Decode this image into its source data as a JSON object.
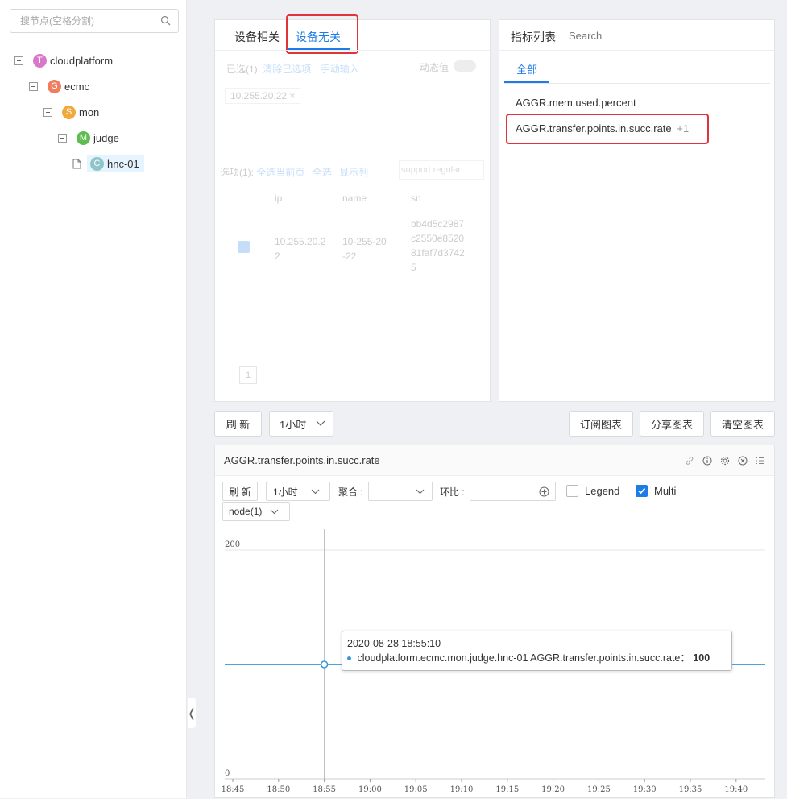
{
  "sidebar": {
    "search_placeholder": "搜节点(空格分割)",
    "tree": [
      {
        "badge": "T",
        "label": "cloudplatform",
        "color": "#d977c9"
      },
      {
        "badge": "G",
        "label": "ecmc",
        "color": "#ef7e5f"
      },
      {
        "badge": "S",
        "label": "mon",
        "color": "#f2a93b"
      },
      {
        "badge": "M",
        "label": "judge",
        "color": "#5fbd4f"
      },
      {
        "badge": "C",
        "label": "hnc-01",
        "color": "#8ec6c9"
      }
    ],
    "collapse_glyph": "❬"
  },
  "device_panel": {
    "tab_related": "设备相关",
    "tab_unrelated": "设备无关",
    "selected_label": "已选(1):",
    "clear_selected": "清除已选项",
    "manual_input": "手动输入",
    "dynamic_label": "动态值",
    "selected_tag": "10.255.20.22 ×",
    "options_label": "选项(1):",
    "select_page": "全选当前页",
    "select_all": "全选",
    "show_cols": "显示列",
    "regex_placeholder": "support regular",
    "columns": [
      "ip",
      "name",
      "sn"
    ],
    "row": [
      "10.255.20.22",
      "10-255-20-22",
      "bb4d5c2987c2550e852081faf7d37425"
    ],
    "page": "1"
  },
  "metric_panel": {
    "title": "指标列表",
    "search_placeholder": "Search",
    "tab_all": "全部",
    "items": [
      {
        "label": "AGGR.mem.used.percent",
        "suffix": ""
      },
      {
        "label": "AGGR.transfer.points.in.succ.rate",
        "suffix": "+1"
      }
    ]
  },
  "toolbar": {
    "refresh": "刷 新",
    "timerange": "1小时",
    "subscribe": "订阅图表",
    "share": "分享图表",
    "clear": "清空图表"
  },
  "chart_panel": {
    "title": "AGGR.transfer.points.in.succ.rate",
    "refresh": "刷 新",
    "timerange": "1小时",
    "aggregate_label": "聚合 :",
    "compare_label": "环比 :",
    "legend_label": "Legend",
    "multi_label": "Multi",
    "legend_checked": false,
    "multi_checked": true,
    "node_select": "node(1)",
    "tooltip_time": "2020-08-28 18:55:10",
    "tooltip_series": "cloudplatform.ecmc.mon.judge.hnc-01 AGGR.transfer.points.in.succ.rate：",
    "tooltip_value": "100"
  },
  "chart_data": {
    "type": "line",
    "x": [
      "18:45",
      "18:50",
      "18:55",
      "19:00",
      "19:05",
      "19:10",
      "19:15",
      "19:20",
      "19:25",
      "19:30",
      "19:35",
      "19:40"
    ],
    "series": [
      {
        "name": "cloudplatform.ecmc.mon.judge.hnc-01 AGGR.transfer.points.in.succ.rate",
        "values": [
          100,
          100,
          100,
          100,
          100,
          100,
          100,
          100,
          100,
          100,
          100,
          100
        ]
      }
    ],
    "y_ticks": [
      "200",
      "0"
    ],
    "ylim": [
      0,
      200
    ],
    "highlight_index": 2,
    "line_color": "#3a96d6",
    "grid": true
  }
}
